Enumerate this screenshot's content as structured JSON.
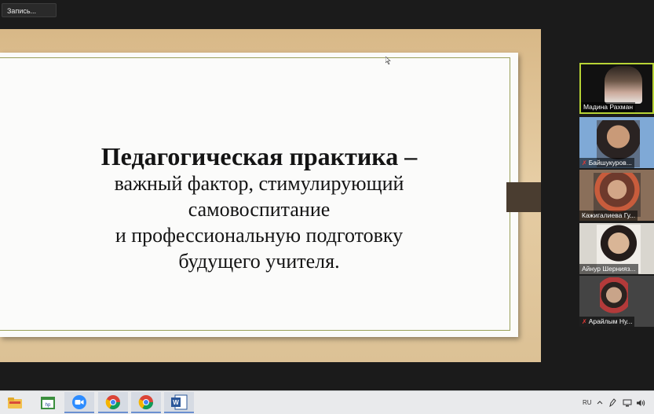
{
  "recording": {
    "label": "Запись..."
  },
  "slide": {
    "title": "Педагогическая практика –",
    "lines": [
      "важный фактор, стимулирующий",
      "самовоспитание",
      "и профессиональную подготовку",
      "будущего учителя."
    ]
  },
  "participants": [
    {
      "name": "Мадина Рахман",
      "muted": false,
      "active": true
    },
    {
      "name": "Байшукуров...",
      "muted": true,
      "active": false
    },
    {
      "name": "Кажигалиева Гу...",
      "muted": false,
      "active": false
    },
    {
      "name": "Айнур Шернияз...",
      "muted": false,
      "active": false
    },
    {
      "name": "Арайлым Ну...",
      "muted": true,
      "active": false
    }
  ],
  "taskbar": {
    "apps": [
      "file-explorer",
      "hp-app",
      "zoom",
      "chrome",
      "chrome",
      "word"
    ],
    "language": "RU"
  },
  "colors": {
    "active_speaker_border": "#b7d335",
    "slide_background": "#d8b887",
    "slide_tab": "#4a3d30"
  }
}
